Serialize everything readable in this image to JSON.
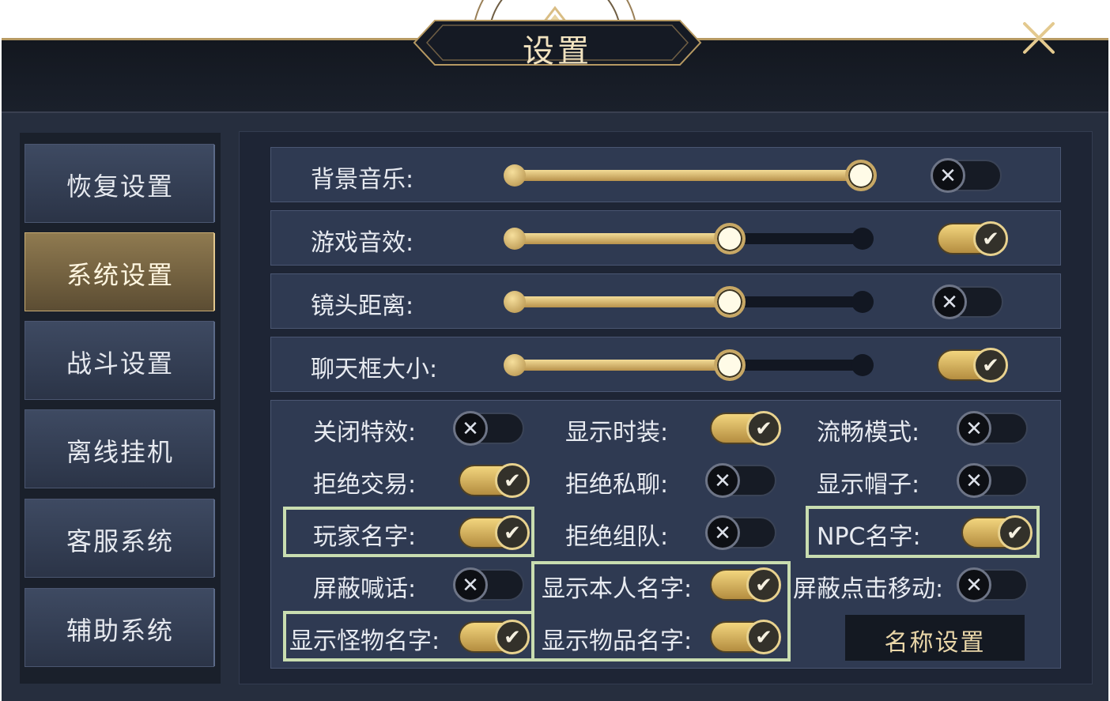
{
  "window": {
    "title": "设置"
  },
  "menu": {
    "items": [
      {
        "label": "恢复设置",
        "active": false
      },
      {
        "label": "系统设置",
        "active": true
      },
      {
        "label": "战斗设置",
        "active": false
      },
      {
        "label": "离线挂机",
        "active": false
      },
      {
        "label": "客服系统",
        "active": false
      },
      {
        "label": "辅助系统",
        "active": false
      }
    ]
  },
  "sliders": [
    {
      "label": "背景音乐:",
      "value": 1.0,
      "enabled": false
    },
    {
      "label": "游戏音效:",
      "value": 0.62,
      "enabled": true
    },
    {
      "label": "镜头距离:",
      "value": 0.62,
      "enabled": false
    },
    {
      "label": "聊天框大小:",
      "value": 0.62,
      "enabled": true
    }
  ],
  "options": [
    {
      "label": "关闭特效:",
      "enabled": false
    },
    {
      "label": "显示时装:",
      "enabled": true
    },
    {
      "label": "流畅模式:",
      "enabled": false
    },
    {
      "label": "拒绝交易:",
      "enabled": true
    },
    {
      "label": "拒绝私聊:",
      "enabled": false
    },
    {
      "label": "显示帽子:",
      "enabled": false
    },
    {
      "label": "玩家名字:",
      "enabled": true
    },
    {
      "label": "拒绝组队:",
      "enabled": false
    },
    {
      "label": "NPC名字:",
      "enabled": true
    },
    {
      "label": "屏蔽喊话:",
      "enabled": false
    },
    {
      "label": "显示本人名字:",
      "enabled": true
    },
    {
      "label": "屏蔽点击移动:",
      "enabled": false
    },
    {
      "label": "显示怪物名字:",
      "enabled": true
    },
    {
      "label": "显示物品名字:",
      "enabled": true
    }
  ],
  "name_settings_button": "名称设置",
  "icons": {
    "close": "close-icon",
    "check": "check-icon",
    "cross": "cross-icon"
  },
  "colors": {
    "gold": "#c9ad74",
    "highlight": "#c9ddb0",
    "panel": "#2f3a52"
  }
}
